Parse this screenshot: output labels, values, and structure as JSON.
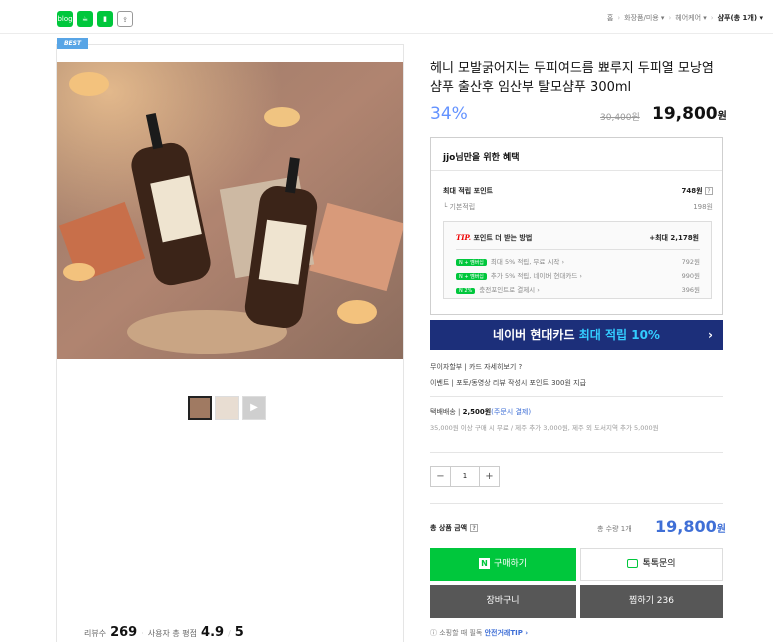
{
  "breadcrumb": {
    "home": "홈",
    "cat1": "화장품/미용 ▾",
    "cat2": "헤어케어 ▾",
    "cat3": "샴푸(총 1개) ▾"
  },
  "share": {
    "blog": "blog",
    "cafe": "cafe",
    "book": "",
    "share": "⇪"
  },
  "badge": "BEST",
  "product": {
    "title": "헤니 모발굵어지는 두피여드름 뾰루지 두피열 모낭염 샴푸 출산후 임산부 탈모샴푸 300ml",
    "discount": "34%",
    "price_old": "30,400원",
    "price_new": "19,800",
    "won": "원"
  },
  "benefit": {
    "heading": "jjo님만을 위한 혜택",
    "max_point_label": "최대 적립 포인트",
    "max_point_value": "748원",
    "base_label": "기본적립",
    "base_value": "198원",
    "tip_head": "포인트 더 받는 방법",
    "tip_label": "TIP.",
    "tip_max": "+최대 2,178원",
    "rows": [
      {
        "badge": "N + 멤버십",
        "text": "최대 5% 적립, 무료 시작 ›",
        "value": "792원"
      },
      {
        "badge": "N + 멤버십",
        "text": "추가 5% 적립, 네이버 현대카드 ›",
        "value": "990원"
      },
      {
        "badge": "N 2%",
        "text": "충전포인트로 결제시 ›",
        "value": "396원"
      }
    ]
  },
  "banner": {
    "text": "네이버 현대카드",
    "highlight": "최대 적립 10%",
    "arrow": "›"
  },
  "info": {
    "line1": "무이자할부 | 카드 자세히보기 ?",
    "line2": "이벤트 | 포토/동영상 리뷰 작성시 포인트 300원 지급"
  },
  "shipping": {
    "label": "택배배송",
    "fee": "2,500원",
    "note_link": "(주문시 결제)",
    "note": "35,000원 이상 구매 시 무료 / 제주 추가 3,000원, 제주 외 도서지역 추가 5,000원"
  },
  "qty": {
    "minus": "−",
    "value": "1",
    "plus": "+"
  },
  "total": {
    "label": "총 상품 금액",
    "help": "?",
    "count": "총 수량 1개",
    "price": "19,800",
    "won": "원"
  },
  "buttons": {
    "buy": "구매하기",
    "talk": "톡톡문의",
    "cart": "장바구니",
    "wish": "찜하기 236"
  },
  "safe_trade": "소핑할 때 필독",
  "safe_trade_link": "안전거래TIP ›",
  "reviews": {
    "count_label": "리뷰수",
    "count": "269",
    "rating_label": "사용자 총 평점",
    "rating": "4.9",
    "max": "5"
  },
  "colors": {
    "naver_green": "#00c73c",
    "accent_blue": "#3f6fd6",
    "discount_blue": "#6392ff",
    "banner_navy": "#1c2f7a"
  }
}
